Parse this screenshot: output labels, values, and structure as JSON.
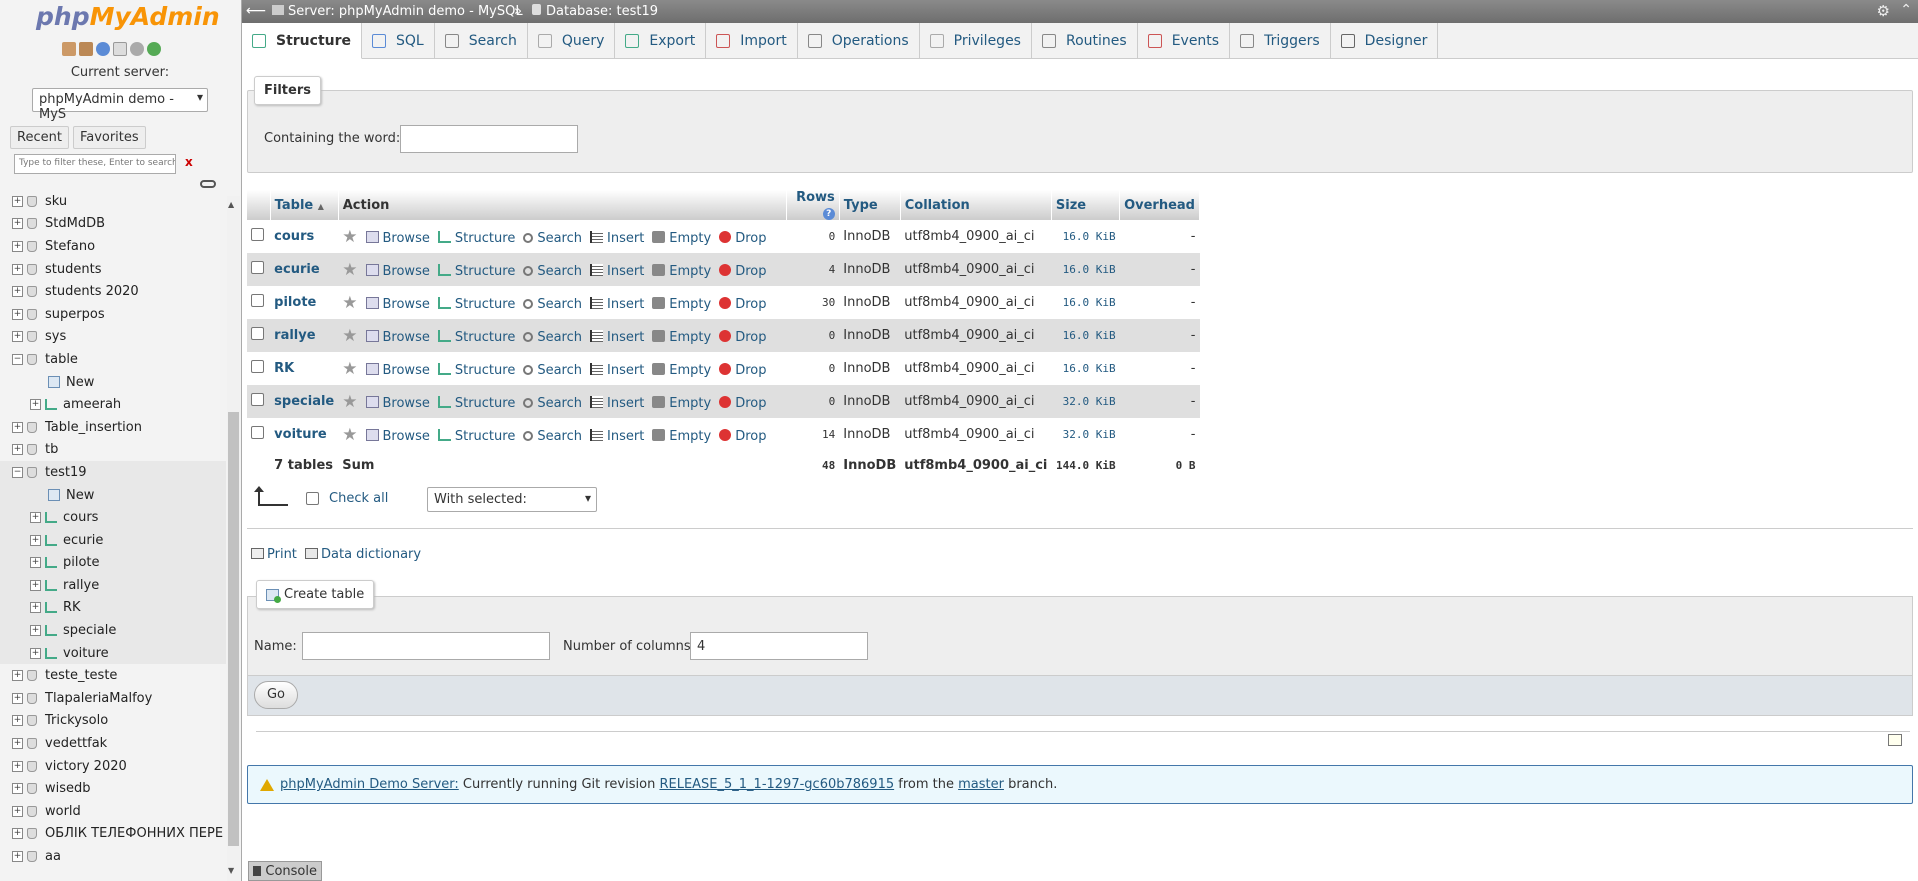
{
  "sidebar": {
    "logo_php": "php",
    "logo_myadmin": "MyAdmin",
    "current_server_label": "Current server:",
    "server_select": "phpMyAdmin demo - MyS",
    "tab_recent": "Recent",
    "tab_favorites": "Favorites",
    "filter_placeholder": "Type to filter these, Enter to search al",
    "filter_clear": "x",
    "tree": [
      {
        "label": "sku",
        "type": "db",
        "level": 0
      },
      {
        "label": "StdMdDB",
        "type": "db",
        "level": 0
      },
      {
        "label": "Stefano",
        "type": "db",
        "level": 0
      },
      {
        "label": "students",
        "type": "db",
        "level": 0
      },
      {
        "label": "students 2020",
        "type": "db",
        "level": 0
      },
      {
        "label": "superpos",
        "type": "db",
        "level": 0
      },
      {
        "label": "sys",
        "type": "db",
        "level": 0
      },
      {
        "label": "table",
        "type": "db",
        "level": 0,
        "expanded": true
      },
      {
        "label": "New",
        "type": "new",
        "level": 1
      },
      {
        "label": "ameerah",
        "type": "table",
        "level": 1
      },
      {
        "label": "Table_insertion",
        "type": "db",
        "level": 0
      },
      {
        "label": "tb",
        "type": "db",
        "level": 0
      },
      {
        "label": "test19",
        "type": "db",
        "level": 0,
        "expanded": true,
        "selected": true
      },
      {
        "label": "New",
        "type": "new",
        "level": 1,
        "selected": true
      },
      {
        "label": "cours",
        "type": "table",
        "level": 1,
        "selected": true
      },
      {
        "label": "ecurie",
        "type": "table",
        "level": 1,
        "selected": true
      },
      {
        "label": "pilote",
        "type": "table",
        "level": 1,
        "selected": true
      },
      {
        "label": "rallye",
        "type": "table",
        "level": 1,
        "selected": true
      },
      {
        "label": "RK",
        "type": "table",
        "level": 1,
        "selected": true
      },
      {
        "label": "speciale",
        "type": "table",
        "level": 1,
        "selected": true
      },
      {
        "label": "voiture",
        "type": "table",
        "level": 1,
        "selected": true
      },
      {
        "label": "teste_teste",
        "type": "db",
        "level": 0
      },
      {
        "label": "TlapaleriaMalfoy",
        "type": "db",
        "level": 0
      },
      {
        "label": "Trickysolo",
        "type": "db",
        "level": 0
      },
      {
        "label": "vedettfak",
        "type": "db",
        "level": 0
      },
      {
        "label": "victory 2020",
        "type": "db",
        "level": 0
      },
      {
        "label": "wisedb",
        "type": "db",
        "level": 0
      },
      {
        "label": "world",
        "type": "db",
        "level": 0
      },
      {
        "label": "ОБЛІК ТЕЛЕФОННИХ ПЕРЕ",
        "type": "db",
        "level": 0
      },
      {
        "label": "aa",
        "type": "db",
        "level": 0
      }
    ]
  },
  "topbar": {
    "server": "Server: phpMyAdmin demo - MySQL",
    "separator": "»",
    "database": "Database: test19"
  },
  "menu": [
    "Structure",
    "SQL",
    "Search",
    "Query",
    "Export",
    "Import",
    "Operations",
    "Privileges",
    "Routines",
    "Events",
    "Triggers",
    "Designer"
  ],
  "filters": {
    "legend": "Filters",
    "containing_label": "Containing the word:",
    "containing_value": ""
  },
  "table": {
    "headers": {
      "table": "Table",
      "action": "Action",
      "rows": "Rows",
      "type": "Type",
      "collation": "Collation",
      "size": "Size",
      "overhead": "Overhead"
    },
    "actions": [
      "Browse",
      "Structure",
      "Search",
      "Insert",
      "Empty",
      "Drop"
    ],
    "rows": [
      {
        "name": "cours",
        "rows": "0",
        "type": "InnoDB",
        "collation": "utf8mb4_0900_ai_ci",
        "size": "16.0 KiB",
        "overhead": "-"
      },
      {
        "name": "ecurie",
        "rows": "4",
        "type": "InnoDB",
        "collation": "utf8mb4_0900_ai_ci",
        "size": "16.0 KiB",
        "overhead": "-"
      },
      {
        "name": "pilote",
        "rows": "30",
        "type": "InnoDB",
        "collation": "utf8mb4_0900_ai_ci",
        "size": "16.0 KiB",
        "overhead": "-"
      },
      {
        "name": "rallye",
        "rows": "0",
        "type": "InnoDB",
        "collation": "utf8mb4_0900_ai_ci",
        "size": "16.0 KiB",
        "overhead": "-"
      },
      {
        "name": "RK",
        "rows": "0",
        "type": "InnoDB",
        "collation": "utf8mb4_0900_ai_ci",
        "size": "16.0 KiB",
        "overhead": "-"
      },
      {
        "name": "speciale",
        "rows": "0",
        "type": "InnoDB",
        "collation": "utf8mb4_0900_ai_ci",
        "size": "32.0 KiB",
        "overhead": "-"
      },
      {
        "name": "voiture",
        "rows": "14",
        "type": "InnoDB",
        "collation": "utf8mb4_0900_ai_ci",
        "size": "32.0 KiB",
        "overhead": "-"
      }
    ],
    "sum": {
      "label": "7 tables",
      "sum_label": "Sum",
      "rows": "48",
      "type": "InnoDB",
      "collation": "utf8mb4_0900_ai_ci",
      "size": "144.0 KiB",
      "overhead": "0 B"
    }
  },
  "bulk": {
    "check_all": "Check all",
    "with_selected": "With selected:"
  },
  "links": {
    "print": "Print",
    "data_dictionary": "Data dictionary"
  },
  "create": {
    "legend": "Create table",
    "name_label": "Name:",
    "name_value": "",
    "columns_label": "Number of columns:",
    "columns_value": "4",
    "go": "Go"
  },
  "notice": {
    "link1": "phpMyAdmin Demo Server:",
    "text1": " Currently running Git revision ",
    "link2": "RELEASE_5_1_1-1297-gc60b786915",
    "text2": " from the ",
    "link3": "master",
    "text3": " branch."
  },
  "console": "Console",
  "colors": {
    "link": "#235a81",
    "logo_php": "#6c78af",
    "logo_myadmin": "#f89406",
    "drop_icon": "#d33"
  }
}
